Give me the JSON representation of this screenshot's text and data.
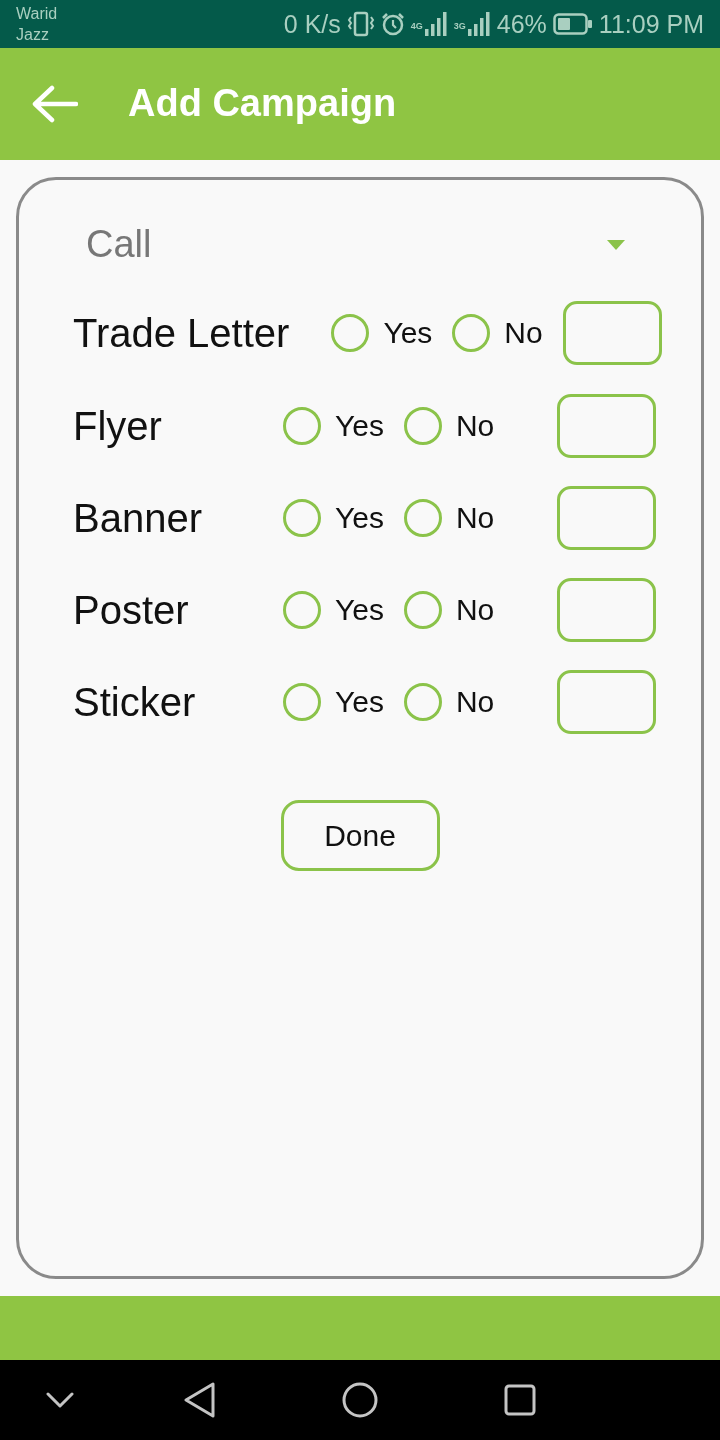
{
  "status_bar": {
    "carrier": [
      "Warid",
      "Jazz"
    ],
    "network_speed": "0 K/s",
    "networks": [
      {
        "type": "4G"
      },
      {
        "type": "3G"
      }
    ],
    "battery": "46%",
    "time": "11:09 PM"
  },
  "app_bar": {
    "title": "Add Campaign"
  },
  "dropdown": {
    "value": "Call"
  },
  "rows": [
    {
      "label": "Trade Letter",
      "options": [
        {
          "label": "Yes",
          "selected": false
        },
        {
          "label": "No",
          "selected": false
        }
      ]
    },
    {
      "label": "Flyer",
      "options": [
        {
          "label": "Yes",
          "selected": false
        },
        {
          "label": "No",
          "selected": false
        }
      ]
    },
    {
      "label": "Banner",
      "options": [
        {
          "label": "Yes",
          "selected": false
        },
        {
          "label": "No",
          "selected": false
        }
      ]
    },
    {
      "label": "Poster",
      "options": [
        {
          "label": "Yes",
          "selected": false
        },
        {
          "label": "No",
          "selected": false
        }
      ]
    },
    {
      "label": "Sticker",
      "options": [
        {
          "label": "Yes",
          "selected": false
        },
        {
          "label": "No",
          "selected": false
        }
      ]
    }
  ],
  "button": "Done"
}
